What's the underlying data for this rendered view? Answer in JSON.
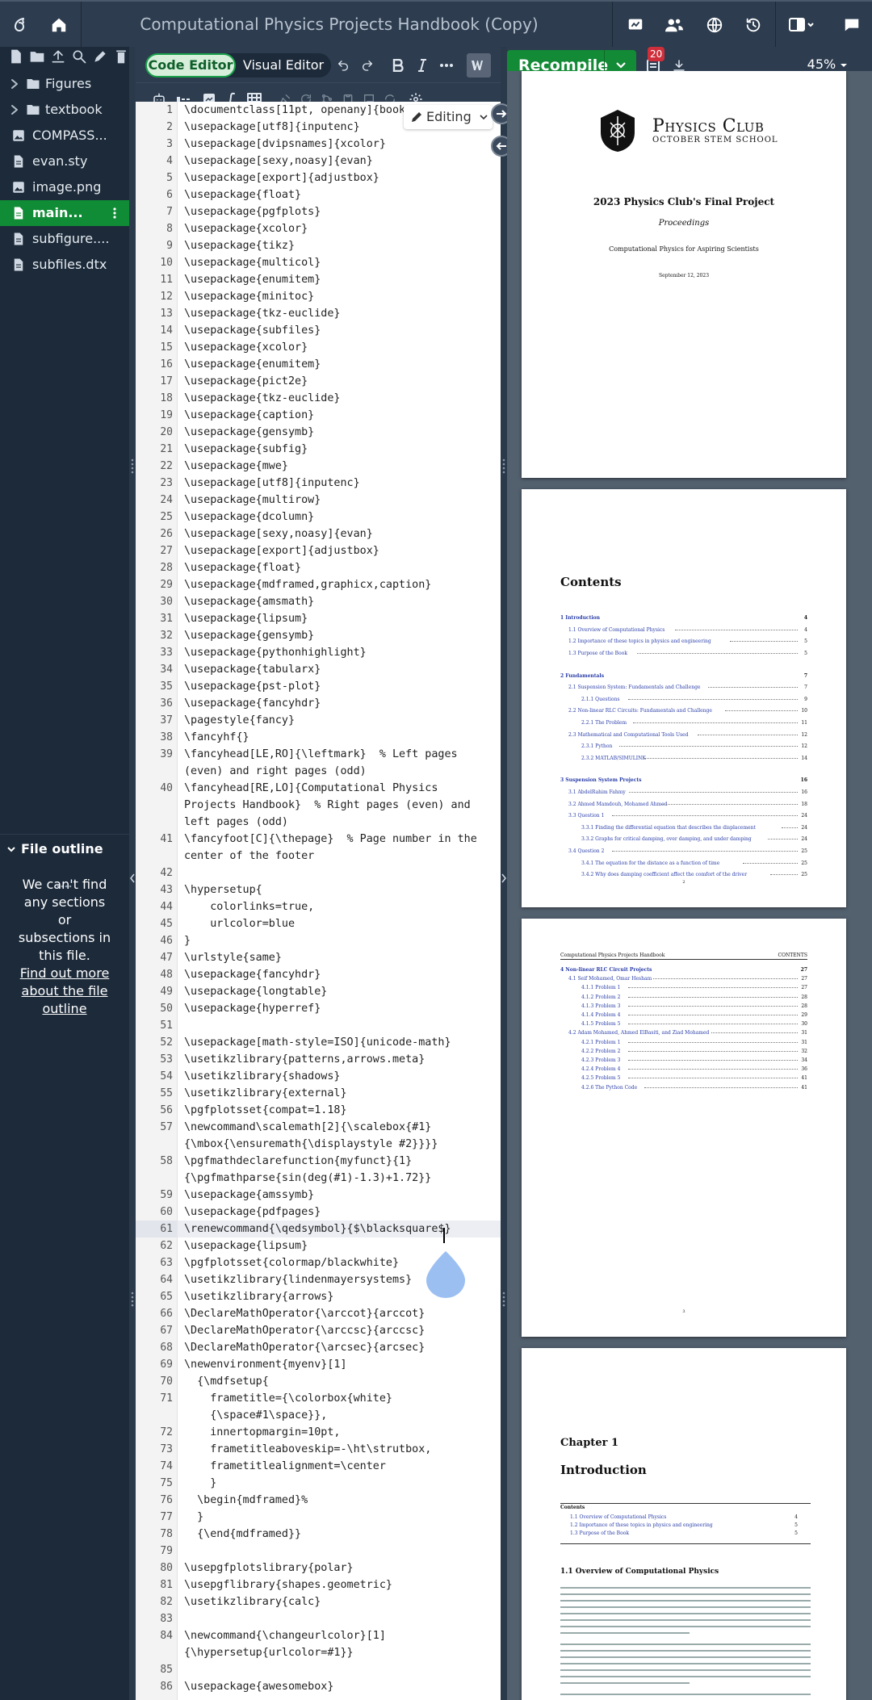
{
  "app": {
    "title": "Computational Physics Projects Handbook (Copy)"
  },
  "topbar": {
    "icons": [
      "overleaf-logo-icon",
      "home-icon",
      "review-icon",
      "share-icon",
      "publish-icon",
      "history-icon",
      "layout-icon",
      "chat-icon"
    ]
  },
  "file_tree": {
    "items": [
      {
        "label": "Figures",
        "type": "folder"
      },
      {
        "label": "textbook",
        "type": "folder"
      },
      {
        "label": "COMPASS...",
        "type": "image"
      },
      {
        "label": "evan.sty",
        "type": "file"
      },
      {
        "label": "image.png",
        "type": "image"
      },
      {
        "label": "main...",
        "type": "file",
        "active": true
      },
      {
        "label": "subfigure....",
        "type": "file"
      },
      {
        "label": "subfiles.dtx",
        "type": "file"
      }
    ]
  },
  "outline": {
    "title": "File outline",
    "message": "We can't find any sections or subsections in this file.",
    "link": "Find out more about the file outline"
  },
  "editor": {
    "code_editor_label": "Code Editor",
    "visual_editor_label": "Visual Editor",
    "editing_label": "Editing",
    "lines": [
      {
        "n": "1",
        "text": "\\documentclass[11pt, openany]{book}"
      },
      {
        "n": "2",
        "text": "\\usepackage[utf8]{inputenc}"
      },
      {
        "n": "3",
        "text": "\\usepackage[dvipsnames]{xcolor}"
      },
      {
        "n": "4",
        "text": "\\usepackage[sexy,noasy]{evan}"
      },
      {
        "n": "5",
        "text": "\\usepackage[export]{adjustbox}"
      },
      {
        "n": "6",
        "text": "\\usepackage{float}"
      },
      {
        "n": "7",
        "text": "\\usepackage{pgfplots}"
      },
      {
        "n": "8",
        "text": "\\usepackage{xcolor}"
      },
      {
        "n": "9",
        "text": "\\usepackage{tikz}"
      },
      {
        "n": "10",
        "text": "\\usepackage{multicol}"
      },
      {
        "n": "11",
        "text": "\\usepackage{enumitem}"
      },
      {
        "n": "12",
        "text": "\\usepackage{minitoc}"
      },
      {
        "n": "13",
        "text": "\\usepackage{tkz-euclide}"
      },
      {
        "n": "14",
        "text": "\\usepackage{subfiles}"
      },
      {
        "n": "15",
        "text": "\\usepackage{xcolor}"
      },
      {
        "n": "16",
        "text": "\\usepackage{enumitem}"
      },
      {
        "n": "17",
        "text": "\\usepackage{pict2e}"
      },
      {
        "n": "18",
        "text": "\\usepackage{tkz-euclide}"
      },
      {
        "n": "19",
        "text": "\\usepackage{caption}"
      },
      {
        "n": "20",
        "text": "\\usepackage{gensymb}"
      },
      {
        "n": "21",
        "text": "\\usepackage{subfig}"
      },
      {
        "n": "22",
        "text": "\\usepackage{mwe}"
      },
      {
        "n": "23",
        "text": "\\usepackage[utf8]{inputenc}"
      },
      {
        "n": "24",
        "text": "\\usepackage{multirow}"
      },
      {
        "n": "25",
        "text": "\\usepackage{dcolumn}"
      },
      {
        "n": "26",
        "text": "\\usepackage[sexy,noasy]{evan}"
      },
      {
        "n": "27",
        "text": "\\usepackage[export]{adjustbox}"
      },
      {
        "n": "28",
        "text": "\\usepackage{float}"
      },
      {
        "n": "29",
        "text": "\\usepackage{mdframed,graphicx,caption}"
      },
      {
        "n": "30",
        "text": "\\usepackage{amsmath}"
      },
      {
        "n": "31",
        "text": "\\usepackage{lipsum}"
      },
      {
        "n": "32",
        "text": "\\usepackage{gensymb}"
      },
      {
        "n": "33",
        "text": "\\usepackage{pythonhighlight}"
      },
      {
        "n": "34",
        "text": "\\usepackage{tabularx}"
      },
      {
        "n": "35",
        "text": "\\usepackage{pst-plot}"
      },
      {
        "n": "36",
        "text": "\\usepackage{fancyhdr}"
      },
      {
        "n": "37",
        "text": "\\pagestyle{fancy}"
      },
      {
        "n": "38",
        "text": "\\fancyhf{}"
      },
      {
        "n": "39",
        "text": "\\fancyhead[LE,RO]{\\leftmark}  % Left pages"
      },
      {
        "n": "",
        "text": "(even) and right pages (odd)"
      },
      {
        "n": "40",
        "text": "\\fancyhead[RE,LO]{Computational Physics"
      },
      {
        "n": "",
        "text": "Projects Handbook}  % Right pages (even) and"
      },
      {
        "n": "",
        "text": "left pages (odd)"
      },
      {
        "n": "41",
        "text": "\\fancyfoot[C]{\\thepage}  % Page number in the"
      },
      {
        "n": "",
        "text": "center of the footer"
      },
      {
        "n": "42",
        "text": ""
      },
      {
        "n": "43",
        "text": "\\hypersetup{"
      },
      {
        "n": "44",
        "text": "    colorlinks=true,"
      },
      {
        "n": "45",
        "text": "    urlcolor=blue"
      },
      {
        "n": "46",
        "text": "}"
      },
      {
        "n": "47",
        "text": "\\urlstyle{same}"
      },
      {
        "n": "48",
        "text": "\\usepackage{fancyhdr}"
      },
      {
        "n": "49",
        "text": "\\usepackage{longtable}"
      },
      {
        "n": "50",
        "text": "\\usepackage{hyperref}"
      },
      {
        "n": "51",
        "text": ""
      },
      {
        "n": "52",
        "text": "\\usepackage[math-style=ISO]{unicode-math}"
      },
      {
        "n": "53",
        "text": "\\usetikzlibrary{patterns,arrows.meta}"
      },
      {
        "n": "54",
        "text": "\\usetikzlibrary{shadows}"
      },
      {
        "n": "55",
        "text": "\\usetikzlibrary{external}"
      },
      {
        "n": "56",
        "text": "\\pgfplotsset{compat=1.18}"
      },
      {
        "n": "57",
        "text": "\\newcommand\\scalemath[2]{\\scalebox{#1}"
      },
      {
        "n": "",
        "text": "{\\mbox{\\ensuremath{\\displaystyle #2}}}}"
      },
      {
        "n": "58",
        "text": "\\pgfmathdeclarefunction{myfunct}{1}"
      },
      {
        "n": "",
        "text": "{\\pgfmathparse{sin(deg(#1)-1.3)+1.72}}"
      },
      {
        "n": "59",
        "text": "\\usepackage{amssymb}"
      },
      {
        "n": "60",
        "text": "\\usepackage{pdfpages}"
      },
      {
        "n": "61",
        "text": "\\renewcommand{\\qedsymbol}{$\\blacksquare$}",
        "active": true
      },
      {
        "n": "62",
        "text": "\\usepackage{lipsum}"
      },
      {
        "n": "63",
        "text": "\\pgfplotsset{colormap/blackwhite}"
      },
      {
        "n": "64",
        "text": "\\usetikzlibrary{lindenmayersystems}"
      },
      {
        "n": "65",
        "text": "\\usetikzlibrary{arrows}"
      },
      {
        "n": "66",
        "text": "\\DeclareMathOperator{\\arccot}{arccot}"
      },
      {
        "n": "67",
        "text": "\\DeclareMathOperator{\\arccsc}{arccsc}"
      },
      {
        "n": "68",
        "text": "\\DeclareMathOperator{\\arcsec}{arcsec}"
      },
      {
        "n": "69",
        "text": "\\newenvironment{myenv}[1]"
      },
      {
        "n": "70",
        "text": "  {\\mdfsetup{"
      },
      {
        "n": "71",
        "text": "    frametitle={\\colorbox{white}"
      },
      {
        "n": "",
        "text": "    {\\space#1\\space}},"
      },
      {
        "n": "72",
        "text": "    innertopmargin=10pt,"
      },
      {
        "n": "73",
        "text": "    frametitleaboveskip=-\\ht\\strutbox,"
      },
      {
        "n": "74",
        "text": "    frametitlealignment=\\center"
      },
      {
        "n": "75",
        "text": "    }"
      },
      {
        "n": "76",
        "text": "  \\begin{mdframed}%"
      },
      {
        "n": "77",
        "text": "  }"
      },
      {
        "n": "78",
        "text": "  {\\end{mdframed}}"
      },
      {
        "n": "79",
        "text": ""
      },
      {
        "n": "80",
        "text": "\\usepgfplotslibrary{polar}"
      },
      {
        "n": "81",
        "text": "\\usepgflibrary{shapes.geometric}"
      },
      {
        "n": "82",
        "text": "\\usetikzlibrary{calc}"
      },
      {
        "n": "83",
        "text": ""
      },
      {
        "n": "84",
        "text": "\\newcommand{\\changeurlcolor}[1]"
      },
      {
        "n": "",
        "text": "{\\hypersetup{urlcolor=#1}}"
      },
      {
        "n": "85",
        "text": ""
      },
      {
        "n": "86",
        "text": "\\usepackage{awesomebox}"
      }
    ]
  },
  "pdf": {
    "recompile_label": "Recompile",
    "error_count": "20",
    "zoom": "45%",
    "cover": {
      "club_name": "Physics Club",
      "school": "October STEM School",
      "title": "2023 Physics Club's Final Project",
      "subtitle": "Proceedings",
      "tagline": "Computational Physics for Aspiring Scientists",
      "date": "September 12, 2023"
    },
    "contents_title": "Contents",
    "toc": [
      {
        "num": "1",
        "label": "Introduction",
        "page": "4",
        "level": 0
      },
      {
        "num": "1.1",
        "label": "Overview of Computational Physics",
        "page": "4",
        "level": 1
      },
      {
        "num": "1.2",
        "label": "Importance of these topics in physics and engineering",
        "page": "5",
        "level": 1
      },
      {
        "num": "1.3",
        "label": "Purpose of the Book",
        "page": "5",
        "level": 1
      },
      {
        "num": "2",
        "label": "Fundamentals",
        "page": "7",
        "level": 0
      },
      {
        "num": "2.1",
        "label": "Suspension System: Fundamentals and Challenge",
        "page": "7",
        "level": 1
      },
      {
        "num": "2.1.1",
        "label": "Questions",
        "page": "9",
        "level": 2
      },
      {
        "num": "2.2",
        "label": "Non-linear RLC Circuits: Fundamentals and Challenge",
        "page": "10",
        "level": 1
      },
      {
        "num": "2.2.1",
        "label": "The Problem",
        "page": "11",
        "level": 2
      },
      {
        "num": "2.3",
        "label": "Mathematical and Computational Tools Used",
        "page": "12",
        "level": 1
      },
      {
        "num": "2.3.1",
        "label": "Python",
        "page": "12",
        "level": 2
      },
      {
        "num": "2.3.2",
        "label": "MATLAB/SIMULINK",
        "page": "14",
        "level": 2
      },
      {
        "num": "3",
        "label": "Suspension System Projects",
        "page": "16",
        "level": 0
      },
      {
        "num": "3.1",
        "label": "AbdelRahim Fahmy",
        "page": "16",
        "level": 1
      },
      {
        "num": "3.2",
        "label": "Ahmed Mamdouh, Mohamed Ahmed",
        "page": "18",
        "level": 1
      },
      {
        "num": "3.3",
        "label": "Question 1",
        "page": "24",
        "level": 1
      },
      {
        "num": "3.3.1",
        "label": "Finding the differential equation that describes the displacement",
        "page": "24",
        "level": 2
      },
      {
        "num": "3.3.2",
        "label": "Graphs for critical damping, over damping, and under damping",
        "page": "24",
        "level": 2
      },
      {
        "num": "3.4",
        "label": "Question 2",
        "page": "25",
        "level": 1
      },
      {
        "num": "3.4.1",
        "label": "The equation for the distance as a function of time",
        "page": "25",
        "level": 2
      },
      {
        "num": "3.4.2",
        "label": "Why does damping coefficient affect the comfort of the driver",
        "page": "25",
        "level": 2
      }
    ],
    "toc_page_number": "2",
    "page3_header_left": "Computational Physics Projects Handbook",
    "page3_header_right": "CONTENTS",
    "toc2": [
      {
        "num": "4",
        "label": "Non-linear RLC Circuit Projects",
        "page": "27",
        "level": 0
      },
      {
        "num": "4.1",
        "label": "Seif Mohamed, Omar Hesham",
        "page": "27",
        "level": 1
      },
      {
        "num": "4.1.1",
        "label": "Problem 1",
        "page": "27",
        "level": 2
      },
      {
        "num": "4.1.2",
        "label": "Problem 2",
        "page": "28",
        "level": 2
      },
      {
        "num": "4.1.3",
        "label": "Problem 3",
        "page": "28",
        "level": 2
      },
      {
        "num": "4.1.4",
        "label": "Problem 4",
        "page": "29",
        "level": 2
      },
      {
        "num": "4.1.5",
        "label": "Problem 5",
        "page": "30",
        "level": 2
      },
      {
        "num": "4.2",
        "label": "Adam Mohamed, Ahmed ElBasiti, and Ziad Mohamed",
        "page": "31",
        "level": 1
      },
      {
        "num": "4.2.1",
        "label": "Problem 1",
        "page": "31",
        "level": 2
      },
      {
        "num": "4.2.2",
        "label": "Problem 2",
        "page": "32",
        "level": 2
      },
      {
        "num": "4.2.3",
        "label": "Problem 3",
        "page": "34",
        "level": 2
      },
      {
        "num": "4.2.4",
        "label": "Problem 4",
        "page": "36",
        "level": 2
      },
      {
        "num": "4.2.5",
        "label": "Problem 5",
        "page": "41",
        "level": 2
      },
      {
        "num": "4.2.6",
        "label": "The Python Code",
        "page": "41",
        "level": 2
      }
    ],
    "toc2_page_number": "3",
    "chapter_label": "Chapter 1",
    "chapter_title": "Introduction",
    "minitoc_title": "Contents",
    "minitoc": [
      {
        "num": "1.1",
        "label": "Overview of Computational Physics",
        "page": "4"
      },
      {
        "num": "1.2",
        "label": "Importance of these topics in physics and engineering",
        "page": "5"
      },
      {
        "num": "1.3",
        "label": "Purpose of the Book",
        "page": "5"
      }
    ],
    "section_title": "1.1   Overview of Computational Physics"
  },
  "colors": {
    "accent_green": "#138a35",
    "topbar": "#2d3c4f",
    "sidebar": "#1c2a3a"
  }
}
